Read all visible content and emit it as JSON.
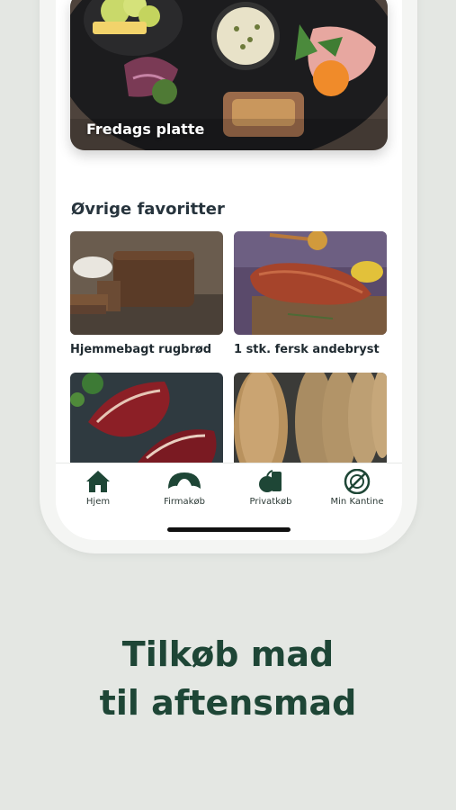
{
  "hero": {
    "label": "Fredags platte"
  },
  "section": {
    "title": "Øvrige favoritter"
  },
  "products": [
    {
      "name": "Hjemmebagt rugbrød"
    },
    {
      "name": "1 stk. fersk andebryst"
    },
    {
      "name": ""
    },
    {
      "name": ""
    }
  ],
  "tabbar": {
    "items": [
      {
        "label": "Hjem",
        "icon": "home-icon"
      },
      {
        "label": "Firmakøb",
        "icon": "croissant-icon"
      },
      {
        "label": "Privatkøb",
        "icon": "groceries-icon"
      },
      {
        "label": "Min Kantine",
        "icon": "plate-icon"
      }
    ],
    "accent": "#1e4636"
  },
  "promo": {
    "line1": "Tilkøb mad",
    "line2": "til aftensmad"
  }
}
